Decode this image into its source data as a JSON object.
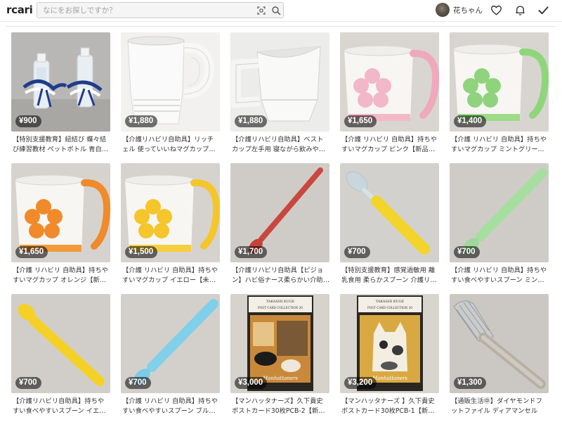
{
  "header": {
    "logo": "rcari",
    "search_placeholder": "なにをお探しですか？",
    "username": "花ちゃん"
  },
  "colors": {
    "price_badge_bg": "#00000088",
    "text": "#333333",
    "border": "#e6e6e6"
  },
  "items": [
    {
      "price": "¥900",
      "title": "【特別支援教育】紐結び 蝶々結び練習教材 ペットボトル 青白ひも"
    },
    {
      "price": "¥1,880",
      "title": "【介護リハビリ自助具】リッチェル 使っていいねマグカップ白【..."
    },
    {
      "price": "¥1,880",
      "title": "【介護リハビリ自助具】ベストカップ左手用 寝ながら飲みやすい..."
    },
    {
      "price": "¥1,650",
      "title": "【介護 リハビリ 自助具】持ちやすいマグカップ ピンク【新品未使..."
    },
    {
      "price": "¥1,400",
      "title": "【介護 リハビリ 自助具】持ちやすいマグカップ ミントグリーン【..."
    },
    {
      "price": "¥1,650",
      "title": "【介護 リハビリ 自助具】持ちやすいマグカップ オレンジ【新品未..."
    },
    {
      "price": "¥1,500",
      "title": "【介護 リハビリ 自助具】持ちやすいマグカップ イエロー【未使用..."
    },
    {
      "price": "¥1,700",
      "title": "【介護リハビリ自助具【ピジョン】ハビ俗ナース柔らかい介助スプ..."
    },
    {
      "price": "¥700",
      "title": "【特別支援教育】感覚過敏用 離乳食用 柔らかスプーン 介護リハビ..."
    },
    {
      "price": "¥700",
      "title": "【介護 リハビリ 自助具】持ちやすい食べやすいスプーン ミントグ..."
    },
    {
      "price": "¥700",
      "title": "【介護リハビリ自助具】持ちやすい食べやすいスプーン イエロー..."
    },
    {
      "price": "¥700",
      "title": "【介護 リハビリ 自助具】持ちやすい食べやすいスプーン ブルー【..."
    },
    {
      "price": "¥3,000",
      "title": "【マンハッタナーズ】久下貴史 ポストカード30枚PCB-2【新品..."
    },
    {
      "price": "¥3,200",
      "title": "【マンハッタナーズ 】久下貴史 ポストカード30枚PCB-1【新品..."
    },
    {
      "price": "¥1,300",
      "title": "【通販生活㊥】ダイヤモンドフットファイル ディアマンセル"
    }
  ],
  "postcard_print": {
    "author": "TAKASHI KUGE",
    "collection": "POST CARD COLLECTION 30",
    "brand": "Manhattaners"
  }
}
